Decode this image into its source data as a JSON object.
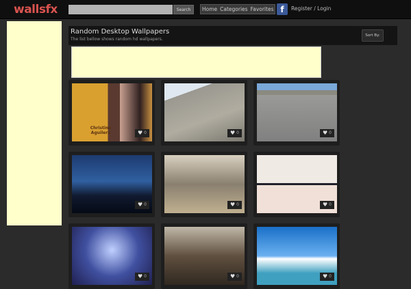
{
  "header": {
    "logo": "wallsfx",
    "search_placeholder": "",
    "search_button": "Search",
    "nav": [
      "Home",
      "Categories",
      "Favorites"
    ],
    "facebook_icon": "f",
    "register": "Register / Login"
  },
  "main": {
    "title": "Random Desktop Wallpapers",
    "subtitle": "The list bellow shows random hd wallpapers.",
    "sort_label": "Sort By:"
  },
  "wallpapers": [
    {
      "likes": "0",
      "caption": "Christina Aguilera"
    },
    {
      "likes": "0"
    },
    {
      "likes": "0"
    },
    {
      "likes": "0"
    },
    {
      "likes": "0"
    },
    {
      "likes": "0"
    },
    {
      "likes": "0"
    },
    {
      "likes": "0"
    },
    {
      "likes": "0"
    }
  ]
}
